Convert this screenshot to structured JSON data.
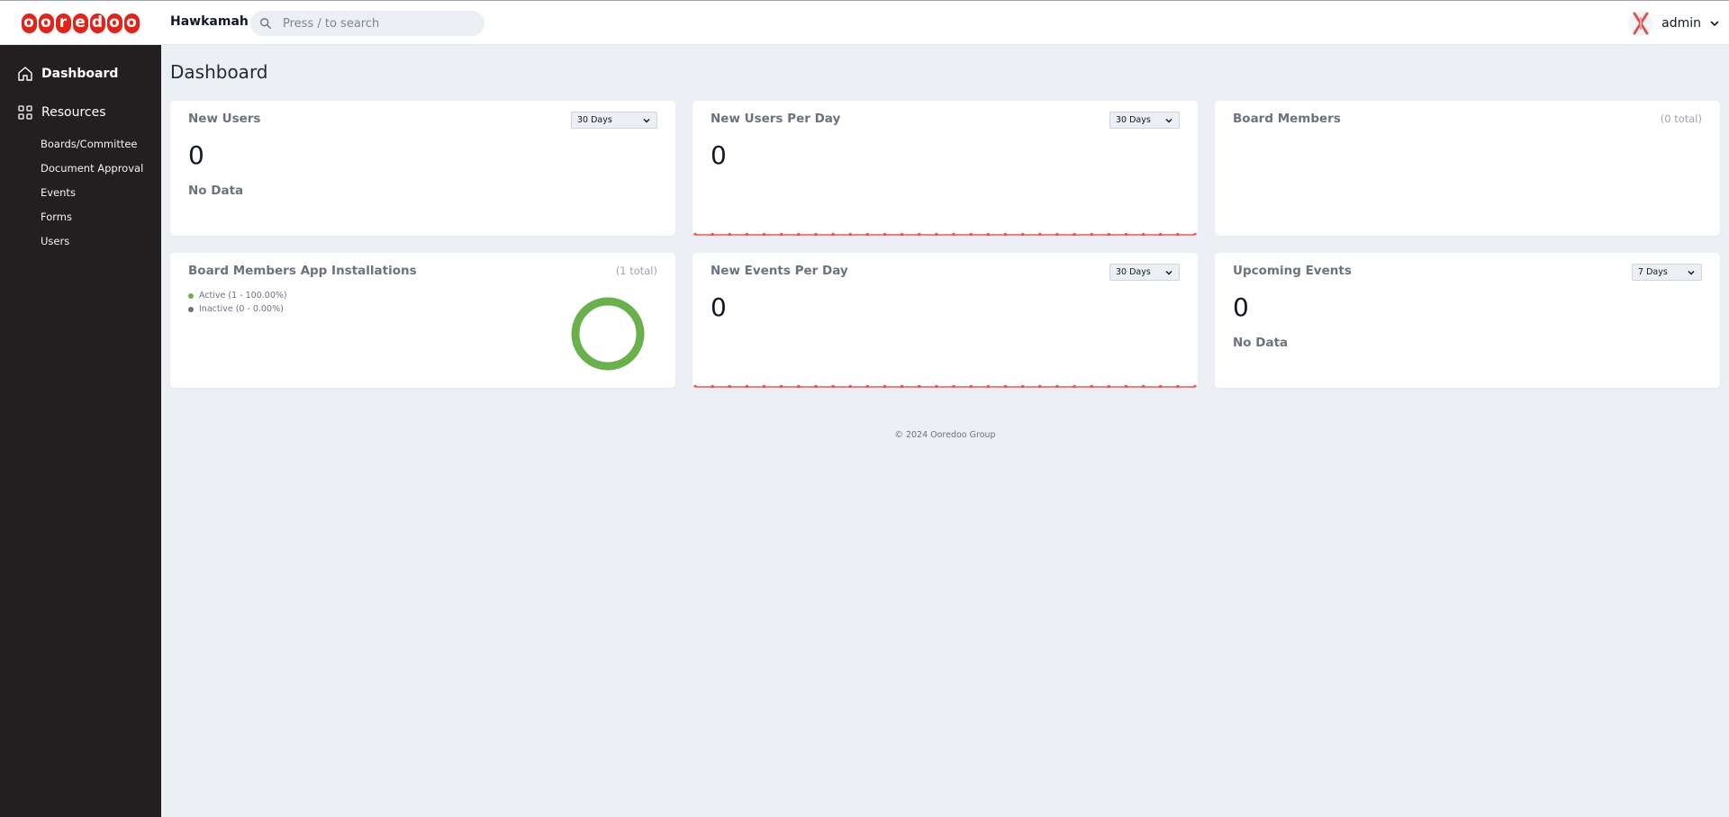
{
  "header": {
    "logo_text": "ooredoo",
    "app_name": "Hawkamah",
    "search_placeholder": "Press / to search",
    "user_name": "admin"
  },
  "sidebar": {
    "main": [
      {
        "label": "Dashboard",
        "icon": "home-icon",
        "active": true
      },
      {
        "label": "Resources",
        "icon": "grid-icon",
        "active": false
      }
    ],
    "sub": [
      "Boards/Committee",
      "Document Approval",
      "Events",
      "Forms",
      "Users"
    ]
  },
  "page": {
    "title": "Dashboard"
  },
  "cards": {
    "new_users": {
      "title": "New Users",
      "range": "30 Days",
      "value": "0",
      "note": "No Data"
    },
    "new_users_per_day": {
      "title": "New Users Per Day",
      "range": "30 Days",
      "value": "0"
    },
    "board_members": {
      "title": "Board Members",
      "total": "(0 total)"
    },
    "app_installations": {
      "title": "Board Members App Installations",
      "total": "(1 total)",
      "legend": [
        {
          "label": "Active (1 - 100.00%)",
          "color": "#6ab04c"
        },
        {
          "label": "Inactive (0 - 0.00%)",
          "color": "#6b7280"
        }
      ]
    },
    "new_events_per_day": {
      "title": "New Events Per Day",
      "range": "30 Days",
      "value": "0"
    },
    "upcoming_events": {
      "title": "Upcoming Events",
      "range": "7 Days",
      "value": "0",
      "note": "No Data"
    }
  },
  "chart_data": {
    "type": "pie",
    "categories": [
      "Active",
      "Inactive"
    ],
    "values": [
      1,
      0
    ],
    "colors": [
      "#6ab04c",
      "#6b7280"
    ]
  },
  "colors": {
    "brand": "#e2231a",
    "sidebar_bg": "#231f20",
    "spark": "#e05a5a",
    "active": "#6ab04c"
  },
  "footer": {
    "text": "© 2024 Ooredoo Group"
  }
}
